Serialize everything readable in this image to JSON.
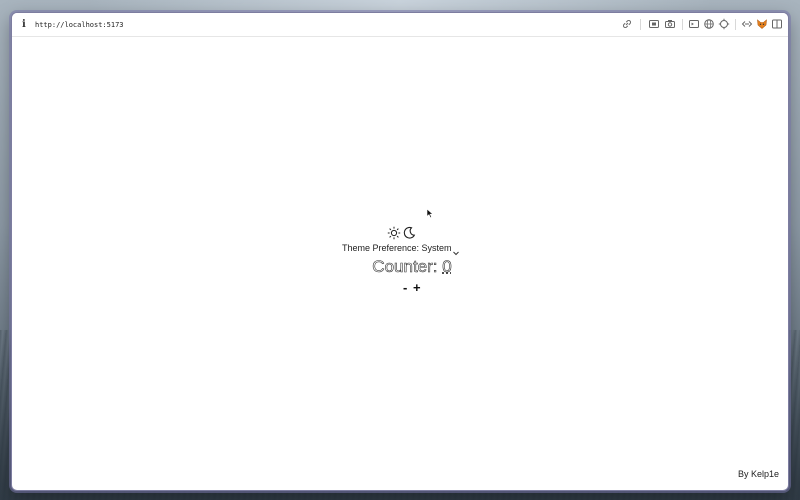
{
  "browser": {
    "url": "http://localhost:5173",
    "toolbar_icons": [
      "link-icon",
      "screenshot-icon",
      "camera-icon",
      "terminal-icon",
      "globe-icon",
      "crosshair-icon",
      "code-icon",
      "fox-icon",
      "sidebar-icon"
    ]
  },
  "theme": {
    "icons": [
      "sun-icon",
      "moon-icon"
    ],
    "preference_label": "Theme Preference: System"
  },
  "counter": {
    "label": "Counter: ",
    "value": "0",
    "decrement_label": "-",
    "increment_label": "+"
  },
  "footer": {
    "byline": "By Kelp1e"
  },
  "colors": {
    "window_border": "#7d7da0",
    "text": "#222222",
    "accent_fox": "#e8821e"
  }
}
